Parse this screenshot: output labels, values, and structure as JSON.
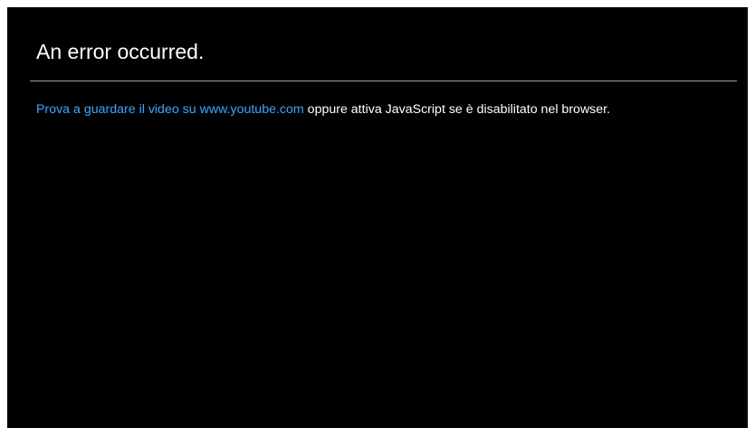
{
  "error": {
    "title": "An error occurred.",
    "message_link": "Prova a guardare il video su www.youtube.com",
    "message_rest": " oppure attiva JavaScript se è disabilitato nel browser."
  },
  "colors": {
    "background": "#000000",
    "text": "#ffffff",
    "link": "#3ea6ff",
    "divider": "#a0a0a0"
  }
}
